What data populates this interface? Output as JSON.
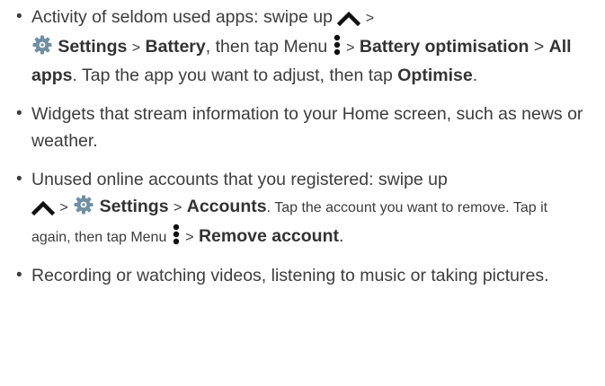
{
  "bullets": [
    {
      "pre": "Activity of seldom used apps: swipe up",
      "gt1": ">",
      "settings": "Settings",
      "gt2": ">",
      "battery": "Battery",
      "then_tap_menu": ", then tap Menu",
      "gt3": ">",
      "battery_optimisation": "Battery optimisation",
      "gt4": ">",
      "all_apps": "All apps",
      "tap_app": ". Tap the app you want to adjust, then tap",
      "optimise": "Optimise",
      "end": "."
    },
    {
      "text": "Widgets that stream information to your Home screen, such as news or weather."
    },
    {
      "pre": "Unused online accounts that you registered: swipe up",
      "gt1": ">",
      "settings": "Settings",
      "gt2": ">",
      "accounts": "Accounts",
      "tap_account": ". Tap the account you want to remove. Tap it again, then tap Menu",
      "gt3": ">",
      "remove_account": "Remove account",
      "end": "."
    },
    {
      "text": "Recording or watching videos, listening to music or taking pictures."
    }
  ],
  "icons": {
    "swipe_up": "chevron-up-icon",
    "settings": "settings-gear-icon",
    "menu": "menu-dots-icon"
  },
  "colors": {
    "text": "#3c3c3c",
    "settings_icon": "#6f8fa3"
  }
}
